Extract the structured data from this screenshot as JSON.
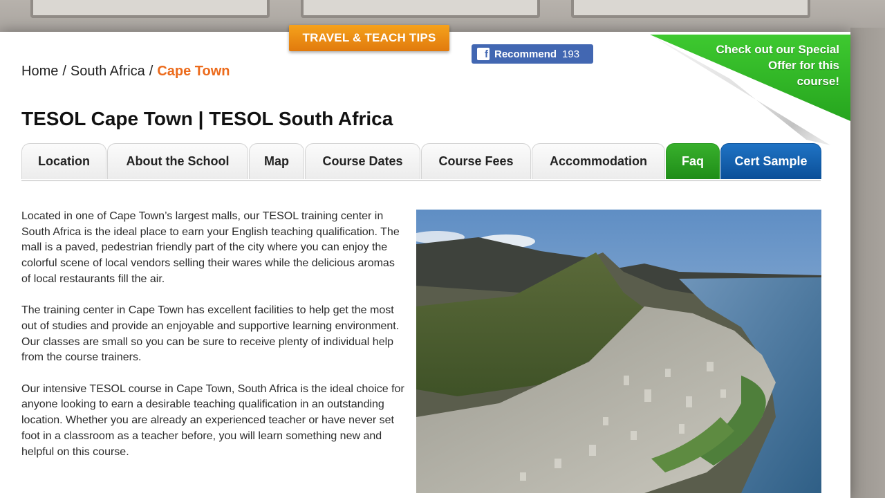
{
  "header": {
    "tips_tab": "TRAVEL & TEACH TIPS",
    "recommend": {
      "label": "Recommend",
      "count": "193",
      "icon": "facebook-icon"
    }
  },
  "breadcrumb": {
    "home": "Home",
    "sep1": "/",
    "country": "South Africa",
    "sep2": "/",
    "current": "Cape Town"
  },
  "title": "TESOL Cape Town | TESOL South Africa",
  "promo": {
    "line1": "Check out our Special",
    "line2": "Offer for this",
    "line3": "course!"
  },
  "tabs": [
    {
      "label": "Location"
    },
    {
      "label": "About the School"
    },
    {
      "label": "Map"
    },
    {
      "label": "Course Dates"
    },
    {
      "label": "Course Fees"
    },
    {
      "label": "Accommodation"
    },
    {
      "label": "Faq"
    },
    {
      "label": "Cert Sample"
    }
  ],
  "content": {
    "paragraphs": [
      "Located in one of Cape Town’s largest malls, our TESOL training center in South Africa is the ideal place to earn your English teaching qualification. The mall is a paved, pedestrian friendly part of the city where you can enjoy the colorful scene of local vendors selling their wares while the delicious aromas of local restaurants fill the air.",
      "The training center in Cape Town has excellent facilities to help get the most out of studies and provide an enjoyable and supportive learning environment. Our classes are small so you can be sure to receive plenty of individual help from the course trainers.",
      "Our intensive TESOL course in Cape Town, South Africa is the ideal choice for anyone looking to earn a desirable teaching qualification in an outstanding location. Whether you are already an experienced teacher or have never set foot in a classroom as a teacher before, you will learn something new and helpful on this course."
    ]
  },
  "colors": {
    "accent_orange": "#ec6b1c",
    "promo_green": "#2fb526",
    "faq_green": "#2a9e21",
    "cert_blue": "#155fae",
    "facebook_blue": "#4267b2"
  }
}
